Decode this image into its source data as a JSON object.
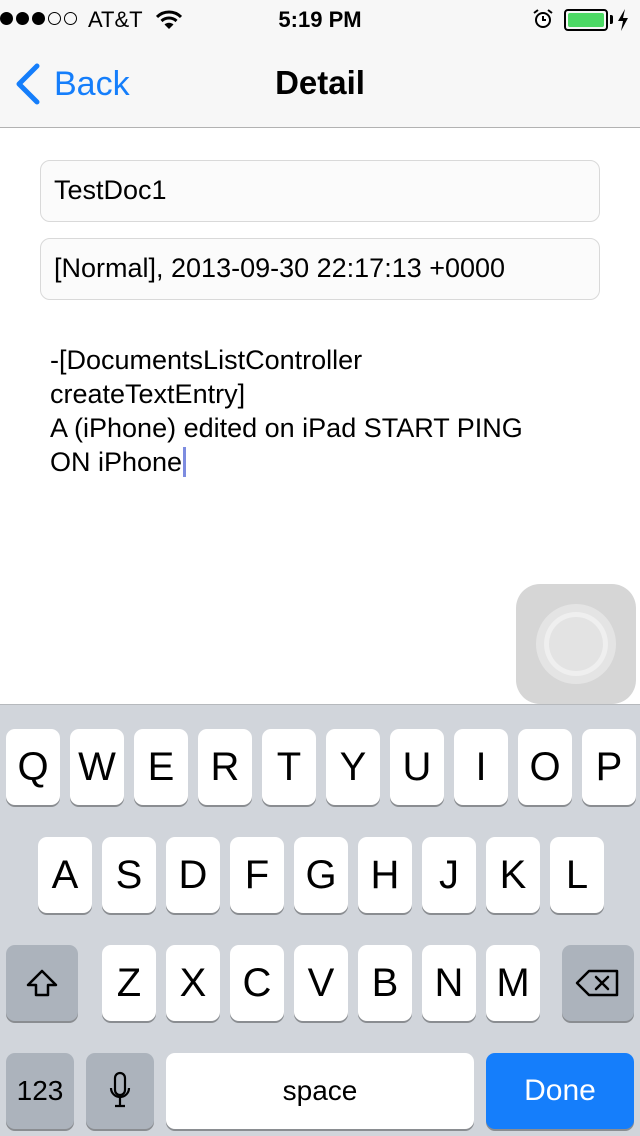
{
  "status_bar": {
    "signal_strength": 3,
    "signal_max": 5,
    "carrier": "AT&T",
    "time": "5:19 PM",
    "battery_level": 1.0,
    "battery_color": "#4cd964",
    "icons": [
      "wifi-icon",
      "alarm-icon",
      "battery-icon",
      "charging-bolt-icon"
    ]
  },
  "nav": {
    "back_label": "Back",
    "title": "Detail",
    "tint_color": "#157efb"
  },
  "form": {
    "name_value": "TestDoc1",
    "status_value": "[Normal], 2013-09-30 22:17:13 +0000",
    "body_lines": [
      "-[DocumentsListController",
      "createTextEntry]",
      "A (iPhone) edited on iPad START PING",
      "ON iPhone"
    ]
  },
  "keyboard": {
    "row1": [
      "Q",
      "W",
      "E",
      "R",
      "T",
      "Y",
      "U",
      "I",
      "O",
      "P"
    ],
    "row2": [
      "A",
      "S",
      "D",
      "F",
      "G",
      "H",
      "J",
      "K",
      "L"
    ],
    "row3": [
      "Z",
      "X",
      "C",
      "V",
      "B",
      "N",
      "M"
    ],
    "numbers_label": "123",
    "space_label": "space",
    "done_label": "Done",
    "done_color": "#157efb"
  }
}
